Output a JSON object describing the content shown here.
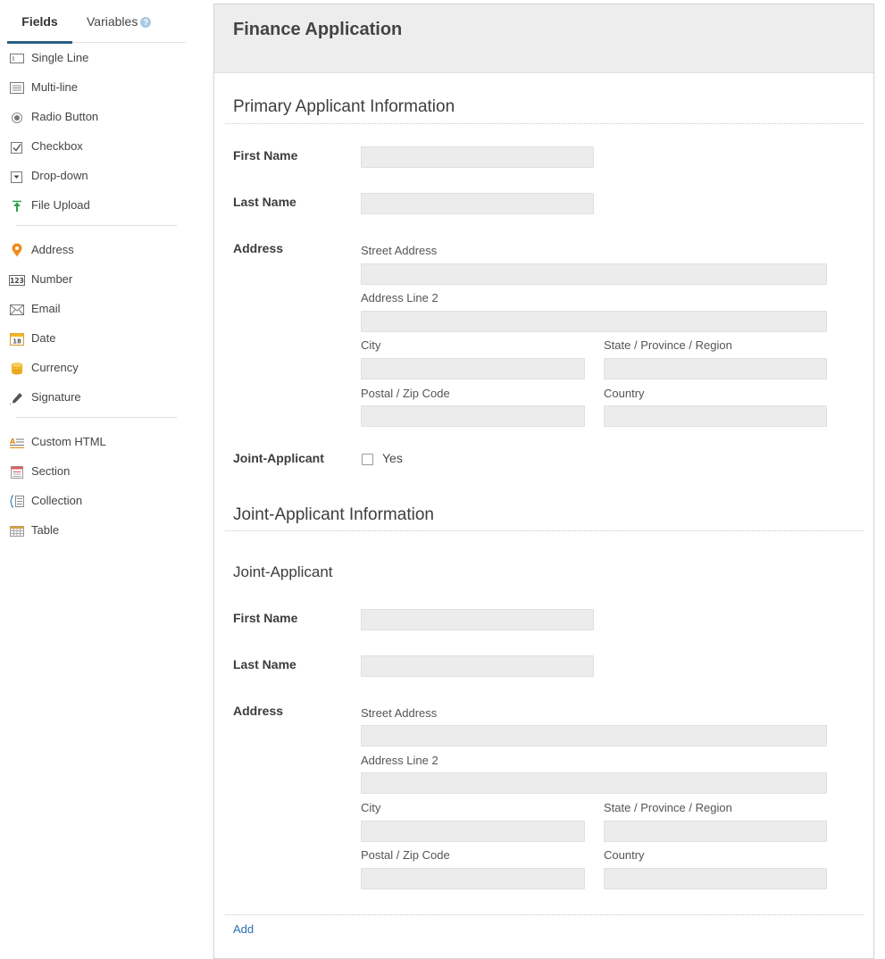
{
  "sidebar": {
    "tabs": {
      "fields": "Fields",
      "variables": "Variables",
      "help": "?"
    },
    "items": [
      {
        "label": "Single Line",
        "icon": "single-line-icon"
      },
      {
        "label": "Multi-line",
        "icon": "multi-line-icon"
      },
      {
        "label": "Radio Button",
        "icon": "radio-button-icon"
      },
      {
        "label": "Checkbox",
        "icon": "checkbox-icon"
      },
      {
        "label": "Drop-down",
        "icon": "dropdown-icon"
      },
      {
        "label": "File Upload",
        "icon": "file-upload-icon"
      },
      {
        "label": "Address",
        "icon": "map-pin-icon"
      },
      {
        "label": "Number",
        "icon": "number-icon"
      },
      {
        "label": "Email",
        "icon": "envelope-icon"
      },
      {
        "label": "Date",
        "icon": "calendar-icon"
      },
      {
        "label": "Currency",
        "icon": "coins-icon"
      },
      {
        "label": "Signature",
        "icon": "pen-icon"
      },
      {
        "label": "Custom HTML",
        "icon": "custom-html-icon"
      },
      {
        "label": "Section",
        "icon": "section-icon"
      },
      {
        "label": "Collection",
        "icon": "collection-icon"
      },
      {
        "label": "Table",
        "icon": "table-icon"
      }
    ],
    "colors": {
      "accent": "#2d5f82",
      "pin": "#f08c1e",
      "upload": "#2e9e4a",
      "currency": "#f2b72a"
    }
  },
  "form": {
    "title": "Finance Application",
    "primary": {
      "title": "Primary Applicant Information",
      "first_name": "First Name",
      "last_name": "Last Name",
      "address": "Address",
      "street": "Street Address",
      "line2": "Address Line 2",
      "city": "City",
      "state": "State / Province / Region",
      "postal": "Postal / Zip Code",
      "country": "Country",
      "joint_label": "Joint-Applicant",
      "joint_option": "Yes"
    },
    "joint": {
      "title": "Joint-Applicant Information",
      "subtitle": "Joint-Applicant",
      "first_name": "First Name",
      "last_name": "Last Name",
      "address": "Address",
      "street": "Street Address",
      "line2": "Address Line 2",
      "city": "City",
      "state": "State / Province / Region",
      "postal": "Postal / Zip Code",
      "country": "Country",
      "add": "Add"
    }
  }
}
